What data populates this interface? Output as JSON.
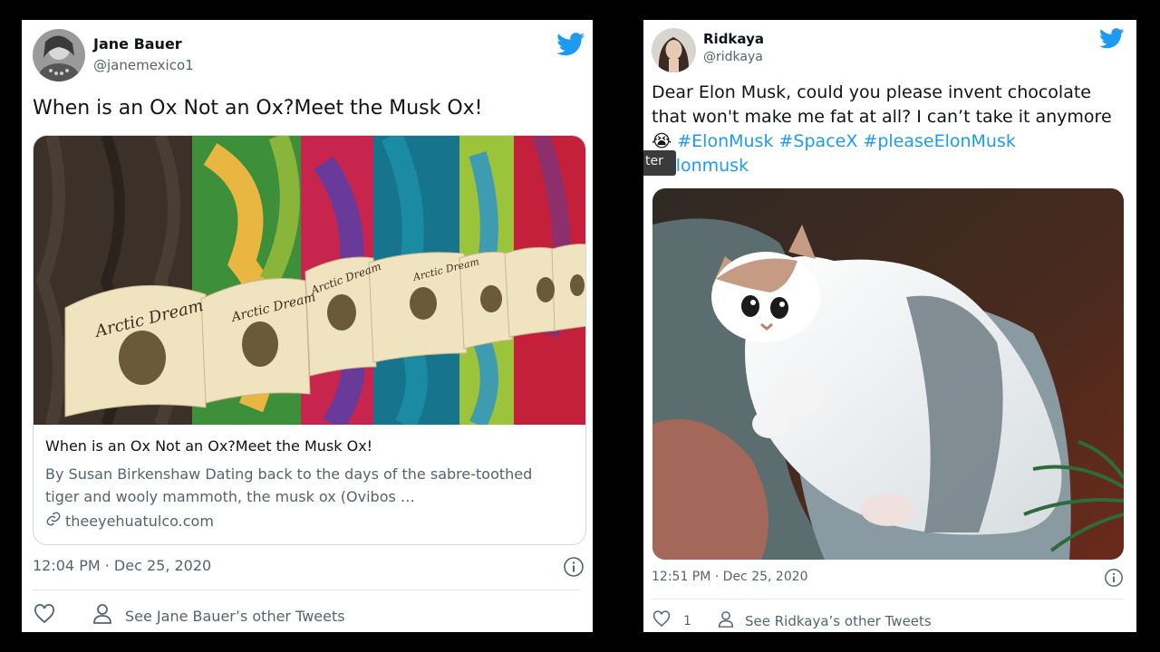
{
  "tweets": [
    {
      "name": "Jane Bauer",
      "handle": "@janemexico1",
      "text": "When is an Ox Not an Ox?Meet the Musk Ox!",
      "link_card": {
        "title": "When is an Ox Not an Ox?Meet the Musk Ox!",
        "description": "By Susan Birkenshaw Dating back to the days of the sabre-toothed tiger and wooly mammoth, the musk ox (Ovibos …",
        "domain": "theeyehuatulco.com",
        "label_text": "Arctic Dream"
      },
      "timestamp": "12:04 PM · Dec 25, 2020",
      "see_other": "See Jane Bauer’s other Tweets",
      "like_count": ""
    },
    {
      "name": "Ridkaya",
      "handle": "@ridkaya",
      "text_line1": "Dear Elon Musk, could you please invent chocolate",
      "text_line2": "that won't make me fat at all? I can’t take it anymore",
      "emoji": "😭",
      "hashtags": [
        "#ElonMusk",
        "#SpaceX",
        "#pleaseElonMusk"
      ],
      "hashtag_tail": "elonmusk",
      "tooltip": "ter",
      "timestamp": "12:51 PM · Dec 25, 2020",
      "like_count": "1",
      "see_other": "See Ridkaya’s other Tweets"
    }
  ],
  "colors": {
    "brand_blue": "#1d9bf0",
    "secondary_text": "#536471",
    "primary_text": "#0f1419"
  },
  "icons": {
    "bird": "twitter-bird-icon",
    "info": "info-icon",
    "like": "heart-icon",
    "profile": "person-icon",
    "link": "link-icon"
  }
}
